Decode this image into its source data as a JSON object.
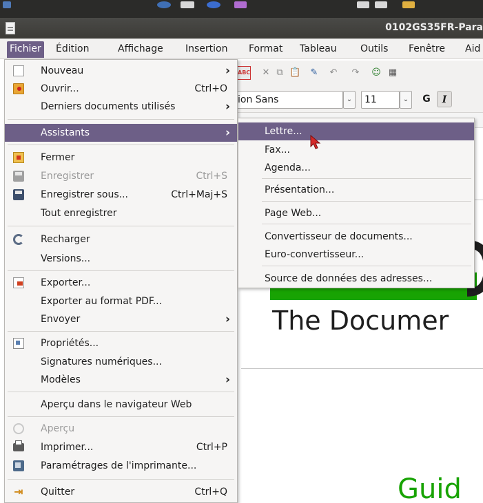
{
  "window": {
    "title": "0102GS35FR-Para"
  },
  "menubar": {
    "items": [
      "Fichier",
      "Édition",
      "Affichage",
      "Insertion",
      "Format",
      "Tableau",
      "Outils",
      "Fenêtre",
      "Aid"
    ]
  },
  "format_bar": {
    "font_name": "ion Sans",
    "font_size": "11",
    "bold_label": "G",
    "italic_label": "I"
  },
  "file_menu": {
    "items": [
      {
        "label": "Nouveau",
        "icon": "new-document-icon",
        "submenu": true
      },
      {
        "label": "Ouvrir...",
        "shortcut": "Ctrl+O",
        "icon": "open-folder-icon"
      },
      {
        "label": "Derniers documents utilisés",
        "submenu": true
      },
      {
        "label": "Assistants",
        "submenu": true,
        "highlighted": true
      },
      {
        "label": "Fermer",
        "icon": "close-document-icon"
      },
      {
        "label": "Enregistrer",
        "shortcut": "Ctrl+S",
        "icon": "save-icon",
        "disabled": true
      },
      {
        "label": "Enregistrer sous...",
        "shortcut": "Ctrl+Maj+S",
        "icon": "save-as-icon"
      },
      {
        "label": "Tout enregistrer"
      },
      {
        "label": "Recharger",
        "icon": "reload-icon"
      },
      {
        "label": "Versions..."
      },
      {
        "label": "Exporter...",
        "icon": "export-icon"
      },
      {
        "label": "Exporter au format PDF..."
      },
      {
        "label": "Envoyer",
        "submenu": true
      },
      {
        "label": "Propriétés...",
        "icon": "properties-icon"
      },
      {
        "label": "Signatures numériques..."
      },
      {
        "label": "Modèles",
        "submenu": true
      },
      {
        "label": "Aperçu dans le navigateur Web"
      },
      {
        "label": "Aperçu",
        "icon": "preview-icon",
        "disabled": true
      },
      {
        "label": "Imprimer...",
        "shortcut": "Ctrl+P",
        "icon": "print-icon"
      },
      {
        "label": "Paramétrages de l'imprimante...",
        "icon": "printer-settings-icon"
      },
      {
        "label": "Quitter",
        "shortcut": "Ctrl+Q",
        "icon": "quit-icon"
      }
    ]
  },
  "wizards_menu": {
    "items": [
      {
        "label": "Lettre...",
        "highlighted": true
      },
      {
        "label": "Fax..."
      },
      {
        "label": "Agenda..."
      },
      {
        "label": "Présentation..."
      },
      {
        "label": "Page Web..."
      },
      {
        "label": "Convertisseur de documents..."
      },
      {
        "label": "Euro-convertisseur..."
      },
      {
        "label": "Source de données des adresses..."
      }
    ]
  },
  "document": {
    "subtitle": "The Documer",
    "guide_text": "Guid"
  },
  "colors": {
    "highlight": "#6d5f87",
    "menu_bg": "#f6f5f4",
    "brand_green": "#18a303"
  }
}
